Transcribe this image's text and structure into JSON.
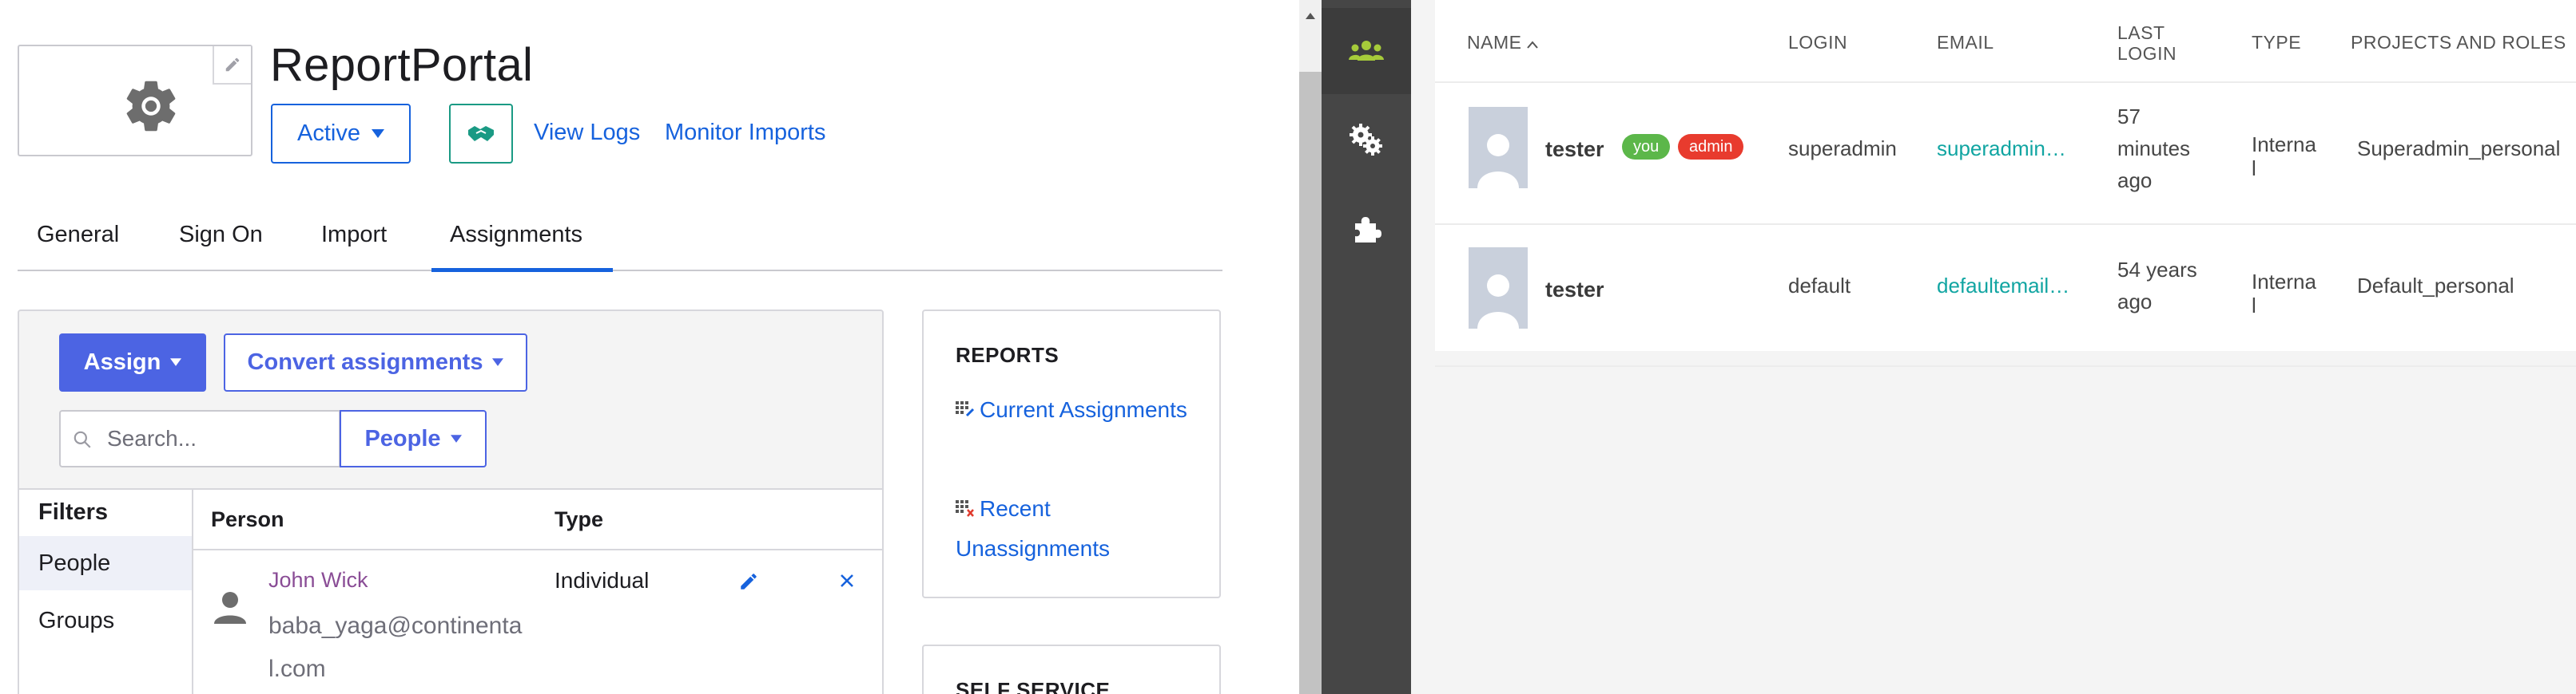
{
  "left_app": {
    "title": "ReportPortal",
    "status_label": "Active",
    "links": {
      "view_logs": "View Logs",
      "monitor_imports": "Monitor Imports"
    },
    "tabs": [
      {
        "label": "General"
      },
      {
        "label": "Sign On"
      },
      {
        "label": "Import"
      },
      {
        "label": "Assignments",
        "active": true
      }
    ],
    "toolbar": {
      "assign_label": "Assign",
      "convert_label": "Convert assignments",
      "search_placeholder": "Search...",
      "people_dropdown": "People"
    },
    "filters": {
      "title": "Filters",
      "items": [
        {
          "label": "People",
          "selected": true
        },
        {
          "label": "Groups"
        }
      ]
    },
    "table": {
      "headers": {
        "person": "Person",
        "type": "Type"
      },
      "rows": [
        {
          "name": "John Wick",
          "email": "baba_yaga@continental.com",
          "type": "Individual"
        }
      ]
    },
    "reports": {
      "title": "REPORTS",
      "links": [
        "Current Assignments",
        "Recent Unassignments"
      ]
    },
    "self_service": {
      "title": "SELF SERVICE"
    }
  },
  "right_app": {
    "sidebar": [
      {
        "icon": "users-icon",
        "active": true,
        "color": "#a6cb3a"
      },
      {
        "icon": "gears-icon"
      },
      {
        "icon": "plugin-icon"
      }
    ],
    "table": {
      "headers": {
        "name": "NAME",
        "login": "LOGIN",
        "email": "EMAIL",
        "last_login": "LAST LOGIN",
        "type": "TYPE",
        "projects": "PROJECTS AND ROLES"
      },
      "rows": [
        {
          "name": "tester",
          "badges": [
            {
              "label": "you",
              "color": "#5cb74a"
            },
            {
              "label": "admin",
              "color": "#e83b2e"
            }
          ],
          "login": "superadmin",
          "email": "superadmin…",
          "last_login": "57 minutes ago",
          "type": "Internal",
          "projects": "Superadmin_personal"
        },
        {
          "name": "tester",
          "badges": [],
          "login": "default",
          "email": "defaultemail…",
          "last_login": "54 years ago",
          "type": "Internal",
          "projects": "Default_personal"
        }
      ]
    }
  }
}
